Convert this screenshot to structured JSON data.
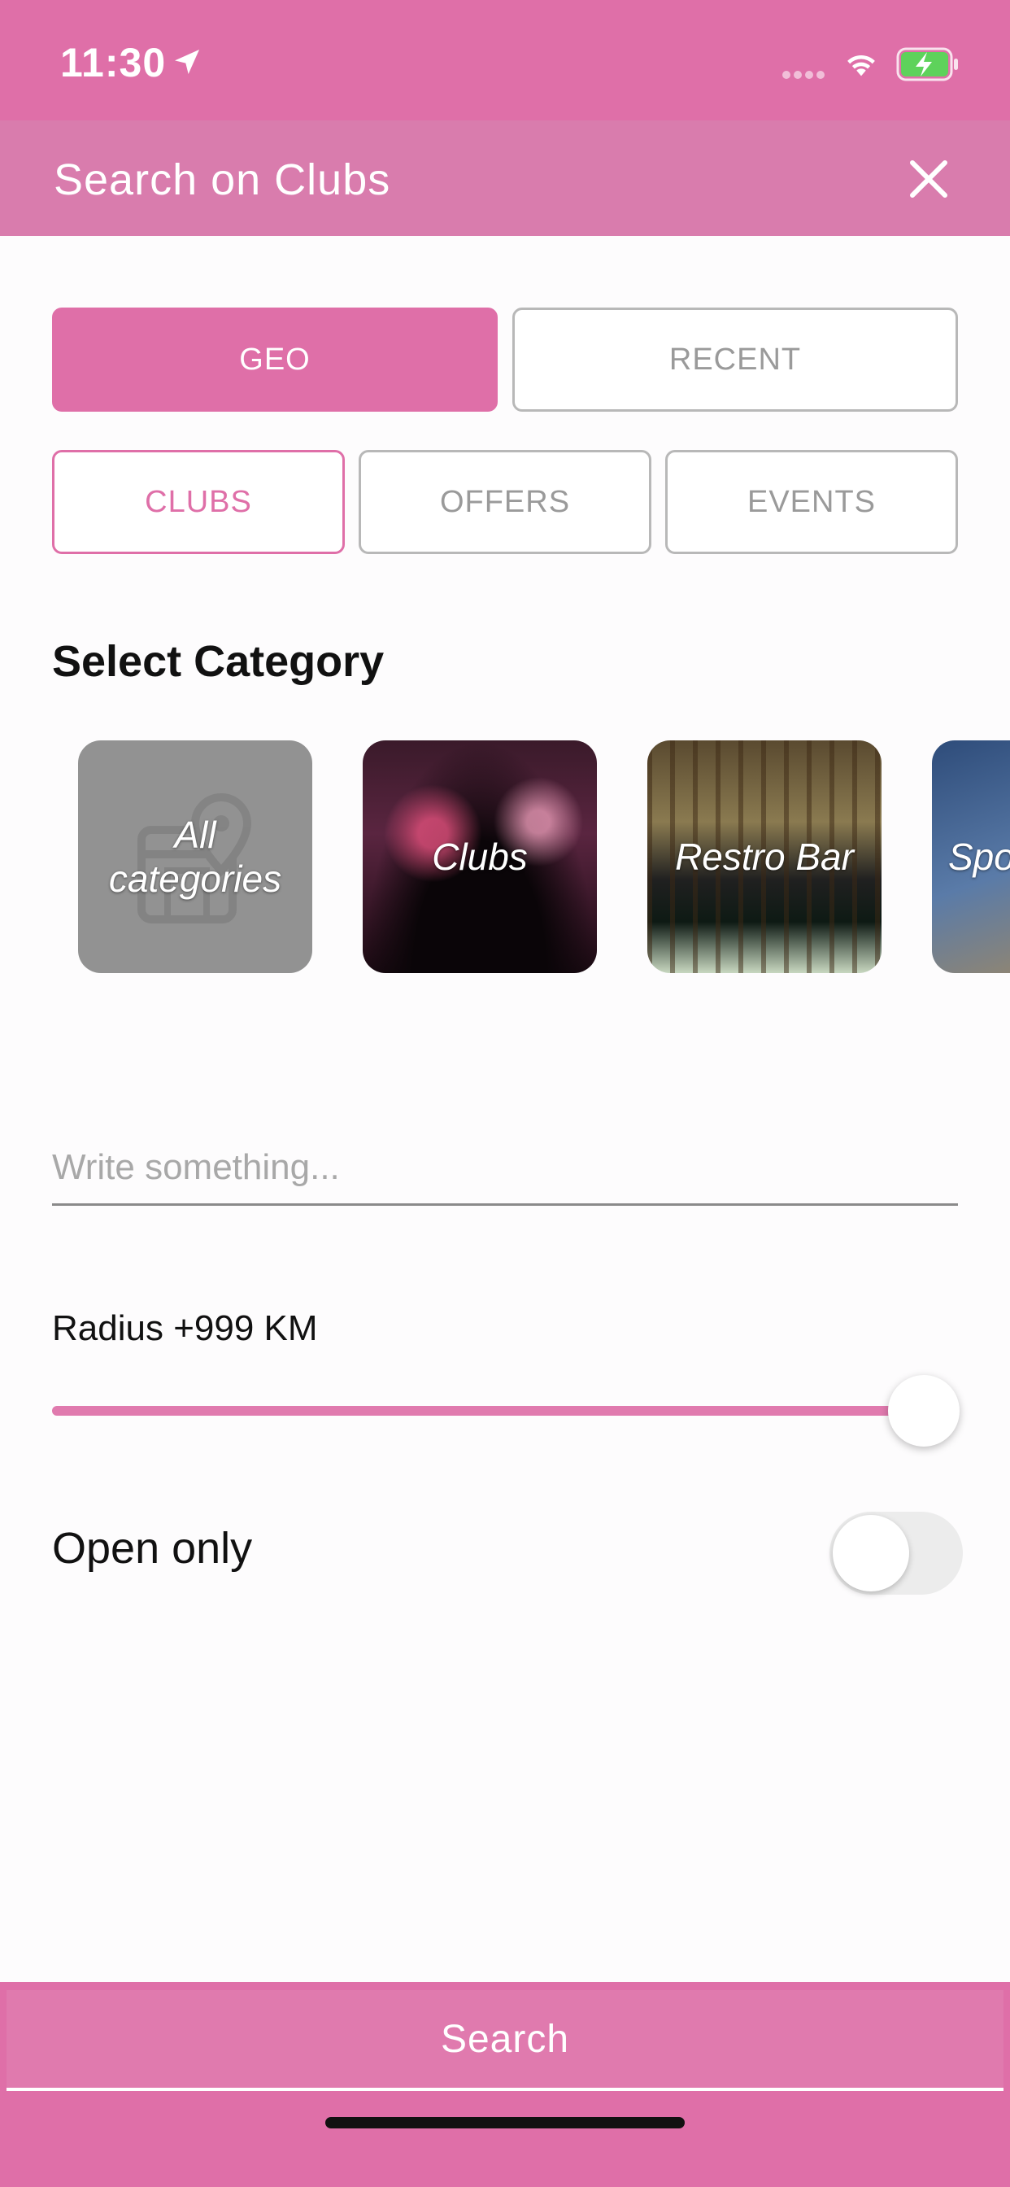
{
  "status_bar": {
    "time": "11:30"
  },
  "header": {
    "title": "Search on Clubs"
  },
  "mode_tabs": [
    {
      "label": "GEO",
      "active": true
    },
    {
      "label": "RECENT",
      "active": false
    }
  ],
  "type_tabs": [
    {
      "label": "CLUBS",
      "active": true
    },
    {
      "label": "OFFERS",
      "active": false
    },
    {
      "label": "EVENTS",
      "active": false
    }
  ],
  "category_section": {
    "title": "Select Category",
    "items": [
      {
        "label": "All categories",
        "icon": "map-pin-shop-icon"
      },
      {
        "label": "Clubs"
      },
      {
        "label": "Restro Bar"
      },
      {
        "label": "Spo"
      }
    ]
  },
  "search_field": {
    "placeholder": "Write something...",
    "value": ""
  },
  "radius": {
    "label": "Radius +999 KM",
    "slider_fraction": 0.97
  },
  "open_only": {
    "label": "Open only",
    "enabled": false
  },
  "search_button": {
    "label": "Search"
  },
  "colors": {
    "accent": "#df6fa8",
    "header": "#d97cad",
    "muted": "#9a9a9a"
  }
}
